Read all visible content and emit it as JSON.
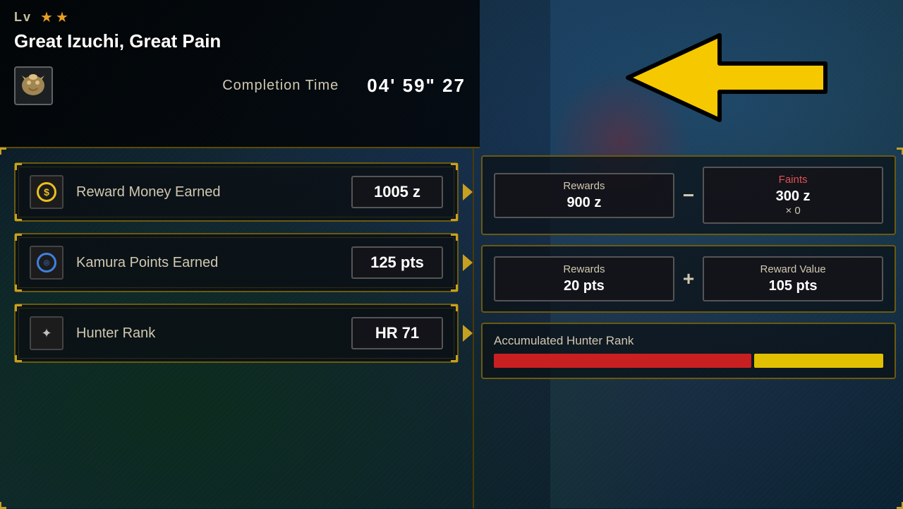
{
  "header": {
    "lv_label": "Lv",
    "stars": [
      "★",
      "★"
    ],
    "quest_title": "Great Izuchi, Great Pain",
    "completion_label": "Completion Time",
    "completion_time": "04' 59\" 27"
  },
  "stats": [
    {
      "id": "money",
      "label": "Reward Money Earned",
      "value": "1005 z",
      "icon_type": "money"
    },
    {
      "id": "kamura",
      "label": "Kamura Points Earned",
      "value": "125 pts",
      "icon_type": "kamura"
    },
    {
      "id": "rank",
      "label": "Hunter Rank",
      "value": "HR 71",
      "icon_type": "hr"
    }
  ],
  "rewards_panels": [
    {
      "left_label": "Rewards",
      "left_value": "900 z",
      "operator": "−",
      "right_label": "Faints",
      "right_label_color": "red",
      "right_sub": "300 z",
      "right_multiplier": "× 0"
    },
    {
      "left_label": "Rewards",
      "left_value": "20 pts",
      "operator": "+",
      "right_label": "Reward Value",
      "right_label_color": "normal",
      "right_sub": "105 pts",
      "right_multiplier": ""
    }
  ],
  "hunter_rank": {
    "title": "Accumulated Hunter Rank",
    "bar_red_flex": 2,
    "bar_yellow_flex": 1
  },
  "arrow": {
    "color": "#f5c800",
    "outline": "#000000"
  }
}
